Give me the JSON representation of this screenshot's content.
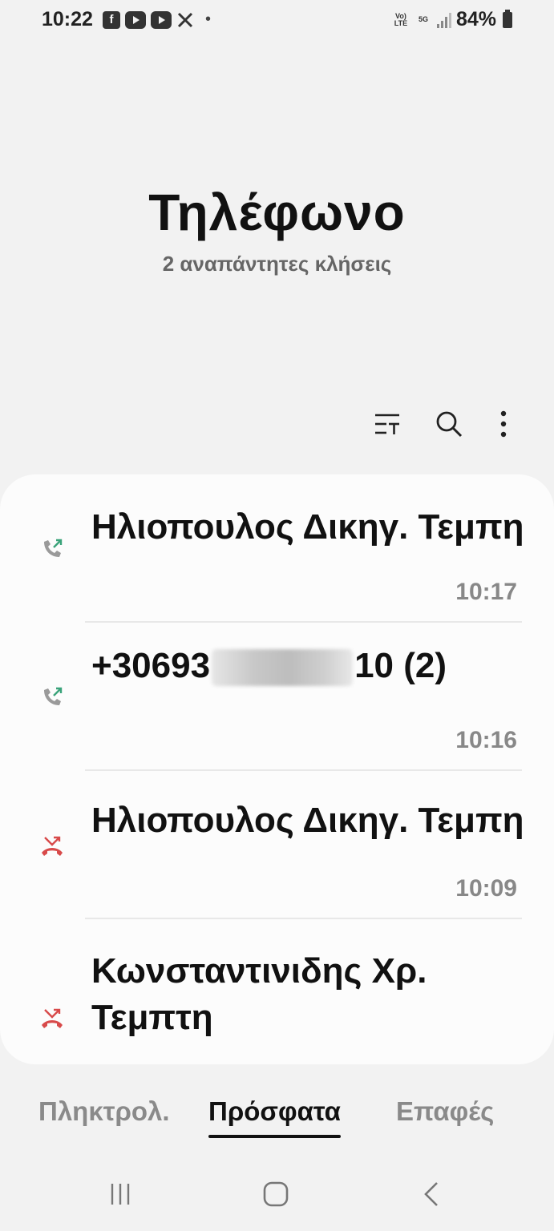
{
  "status_bar": {
    "time": "10:22",
    "notification_icons": [
      "facebook-icon",
      "youtube-icon",
      "youtube-icon",
      "x-icon"
    ],
    "dot": "•",
    "volte": "Vo) LTE",
    "network": "5G",
    "battery": "84%"
  },
  "header": {
    "title": "Τηλέφωνο",
    "subtitle": "2 αναπάντητες κλήσεις"
  },
  "toolbar": {
    "icons": [
      "filter-icon",
      "search-icon",
      "more-vert-icon"
    ]
  },
  "calls": [
    {
      "name": "Ηλιοπουλος Δικηγ. Τεμπη",
      "time": "10:17",
      "type": "outgoing",
      "icon": "outgoing-call-icon"
    },
    {
      "name_prefix": "+30693",
      "name_suffix": "10 (2)",
      "time": "10:16",
      "type": "outgoing",
      "icon": "outgoing-call-icon"
    },
    {
      "name": "Ηλιοπουλος Δικηγ. Τεμπη",
      "time": "10:09",
      "type": "missed",
      "icon": "missed-call-icon"
    },
    {
      "name": "Κωνσταντινιδης Χρ. Τεμπτη",
      "time": "",
      "type": "missed",
      "icon": "missed-call-icon"
    }
  ],
  "tabs": [
    {
      "label": "Πληκτρολ.",
      "active": false
    },
    {
      "label": "Πρόσφατα",
      "active": true
    },
    {
      "label": "Επαφές",
      "active": false
    }
  ],
  "navbar": {
    "icons": [
      "recent-apps-icon",
      "home-icon",
      "back-icon"
    ]
  },
  "colors": {
    "outgoing": "#3aa37a",
    "missed": "#d84a4a",
    "background": "#f2f2f2",
    "card": "#fcfcfc"
  }
}
